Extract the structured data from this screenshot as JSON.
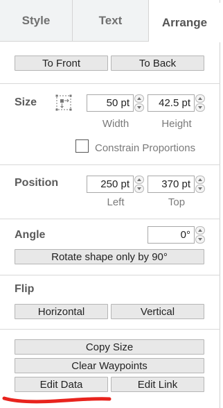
{
  "tabs": [
    {
      "label": "Style"
    },
    {
      "label": "Text"
    },
    {
      "label": "Arrange"
    }
  ],
  "order": {
    "to_front": "To Front",
    "to_back": "To Back"
  },
  "size": {
    "label": "Size",
    "width_value": "50 pt",
    "height_value": "42.5 pt",
    "width_label": "Width",
    "height_label": "Height",
    "constrain_label": "Constrain Proportions"
  },
  "position": {
    "label": "Position",
    "left_value": "250 pt",
    "top_value": "370 pt",
    "left_label": "Left",
    "top_label": "Top"
  },
  "angle": {
    "label": "Angle",
    "value": "0°",
    "rotate_button": "Rotate shape only by 90°"
  },
  "flip": {
    "label": "Flip",
    "horizontal": "Horizontal",
    "vertical": "Vertical"
  },
  "actions": {
    "copy_size": "Copy Size",
    "clear_waypoints": "Clear Waypoints",
    "edit_data": "Edit Data",
    "edit_link": "Edit Link"
  },
  "colors": {
    "annotation_stroke": "#e8231d"
  }
}
